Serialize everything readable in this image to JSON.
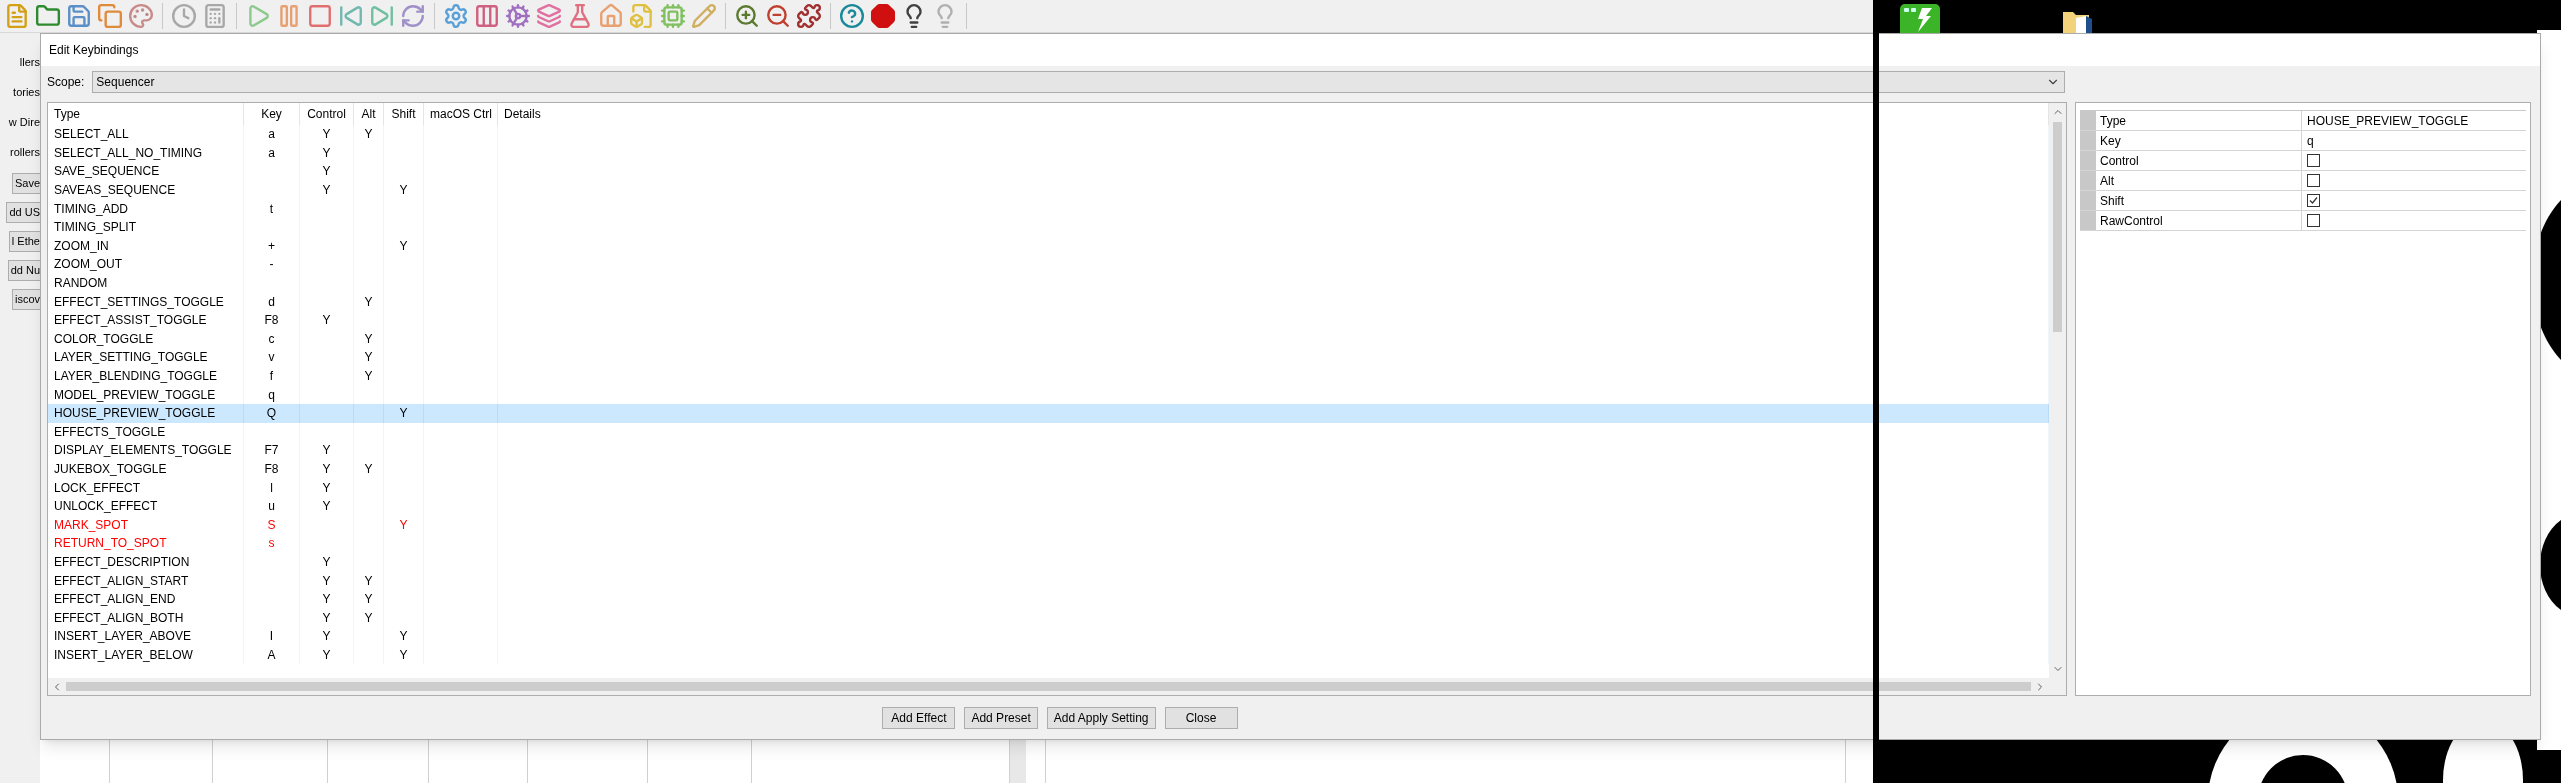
{
  "background_app": {
    "side_items": [
      {
        "kind": "label",
        "text": "llers"
      },
      {
        "kind": "label",
        "text": "tories"
      },
      {
        "kind": "label",
        "text": "w Dire"
      },
      {
        "kind": "label",
        "text": "rollers"
      },
      {
        "kind": "button",
        "text": "Save"
      },
      {
        "kind": "button",
        "text": "dd US"
      },
      {
        "kind": "button",
        "text": "l Ethe"
      },
      {
        "kind": "button",
        "text": "dd Nu"
      },
      {
        "kind": "button",
        "text": "iscov"
      }
    ]
  },
  "dialog": {
    "title": "Edit Keybindings",
    "scope": {
      "label": "Scope:",
      "value": "Sequencer"
    },
    "table": {
      "columns": [
        "Type",
        "Key",
        "Control",
        "Alt",
        "Shift",
        "macOS Ctrl",
        "Details"
      ],
      "rows": [
        {
          "type": "SELECT_ALL",
          "key": "a",
          "control": "Y",
          "alt": "Y",
          "selected": false,
          "warning": false
        },
        {
          "type": "SELECT_ALL_NO_TIMING",
          "key": "a",
          "control": "Y",
          "selected": false,
          "warning": false
        },
        {
          "type": "SAVE_SEQUENCE",
          "control": "Y",
          "selected": false,
          "warning": false
        },
        {
          "type": "SAVEAS_SEQUENCE",
          "control": "Y",
          "shift": "Y",
          "selected": false,
          "warning": false
        },
        {
          "type": "TIMING_ADD",
          "key": "t",
          "selected": false,
          "warning": false
        },
        {
          "type": "TIMING_SPLIT",
          "selected": false,
          "warning": false
        },
        {
          "type": "ZOOM_IN",
          "key": "+",
          "shift": "Y",
          "selected": false,
          "warning": false
        },
        {
          "type": "ZOOM_OUT",
          "key": "-",
          "selected": false,
          "warning": false
        },
        {
          "type": "RANDOM",
          "selected": false,
          "warning": false
        },
        {
          "type": "EFFECT_SETTINGS_TOGGLE",
          "key": "d",
          "alt": "Y",
          "selected": false,
          "warning": false
        },
        {
          "type": "EFFECT_ASSIST_TOGGLE",
          "key": "F8",
          "control": "Y",
          "selected": false,
          "warning": false
        },
        {
          "type": "COLOR_TOGGLE",
          "key": "c",
          "alt": "Y",
          "selected": false,
          "warning": false
        },
        {
          "type": "LAYER_SETTING_TOGGLE",
          "key": "v",
          "alt": "Y",
          "selected": false,
          "warning": false
        },
        {
          "type": "LAYER_BLENDING_TOGGLE",
          "key": "f",
          "alt": "Y",
          "selected": false,
          "warning": false
        },
        {
          "type": "MODEL_PREVIEW_TOGGLE",
          "key": "q",
          "selected": false,
          "warning": false
        },
        {
          "type": "HOUSE_PREVIEW_TOGGLE",
          "key": "Q",
          "shift": "Y",
          "selected": true,
          "warning": false
        },
        {
          "type": "EFFECTS_TOGGLE",
          "selected": false,
          "warning": false
        },
        {
          "type": "DISPLAY_ELEMENTS_TOGGLE",
          "key": "F7",
          "control": "Y",
          "selected": false,
          "warning": false
        },
        {
          "type": "JUKEBOX_TOGGLE",
          "key": "F8",
          "control": "Y",
          "alt": "Y",
          "selected": false,
          "warning": false
        },
        {
          "type": "LOCK_EFFECT",
          "key": "l",
          "control": "Y",
          "selected": false,
          "warning": false
        },
        {
          "type": "UNLOCK_EFFECT",
          "key": "u",
          "control": "Y",
          "selected": false,
          "warning": false
        },
        {
          "type": "MARK_SPOT",
          "key": "S",
          "shift": "Y",
          "selected": false,
          "warning": true
        },
        {
          "type": "RETURN_TO_SPOT",
          "key": "s",
          "selected": false,
          "warning": true
        },
        {
          "type": "EFFECT_DESCRIPTION",
          "control": "Y",
          "selected": false,
          "warning": false
        },
        {
          "type": "EFFECT_ALIGN_START",
          "control": "Y",
          "alt": "Y",
          "selected": false,
          "warning": false
        },
        {
          "type": "EFFECT_ALIGN_END",
          "control": "Y",
          "alt": "Y",
          "selected": false,
          "warning": false
        },
        {
          "type": "EFFECT_ALIGN_BOTH",
          "control": "Y",
          "alt": "Y",
          "selected": false,
          "warning": false
        },
        {
          "type": "INSERT_LAYER_ABOVE",
          "key": "I",
          "control": "Y",
          "shift": "Y",
          "selected": false,
          "warning": false
        },
        {
          "type": "INSERT_LAYER_BELOW",
          "key": "A",
          "control": "Y",
          "shift": "Y",
          "selected": false,
          "warning": false
        }
      ]
    },
    "properties": [
      {
        "kind": "text",
        "name": "Type",
        "value": "HOUSE_PREVIEW_TOGGLE"
      },
      {
        "kind": "text",
        "name": "Key",
        "value": "q"
      },
      {
        "kind": "checkbox",
        "name": "Control",
        "checked": false
      },
      {
        "kind": "checkbox",
        "name": "Alt",
        "checked": false
      },
      {
        "kind": "checkbox",
        "name": "Shift",
        "checked": true
      },
      {
        "kind": "checkbox",
        "name": "RawControl",
        "checked": false
      }
    ],
    "buttons": [
      "Add Effect",
      "Add Preset",
      "Add Apply Setting",
      "Close"
    ]
  }
}
